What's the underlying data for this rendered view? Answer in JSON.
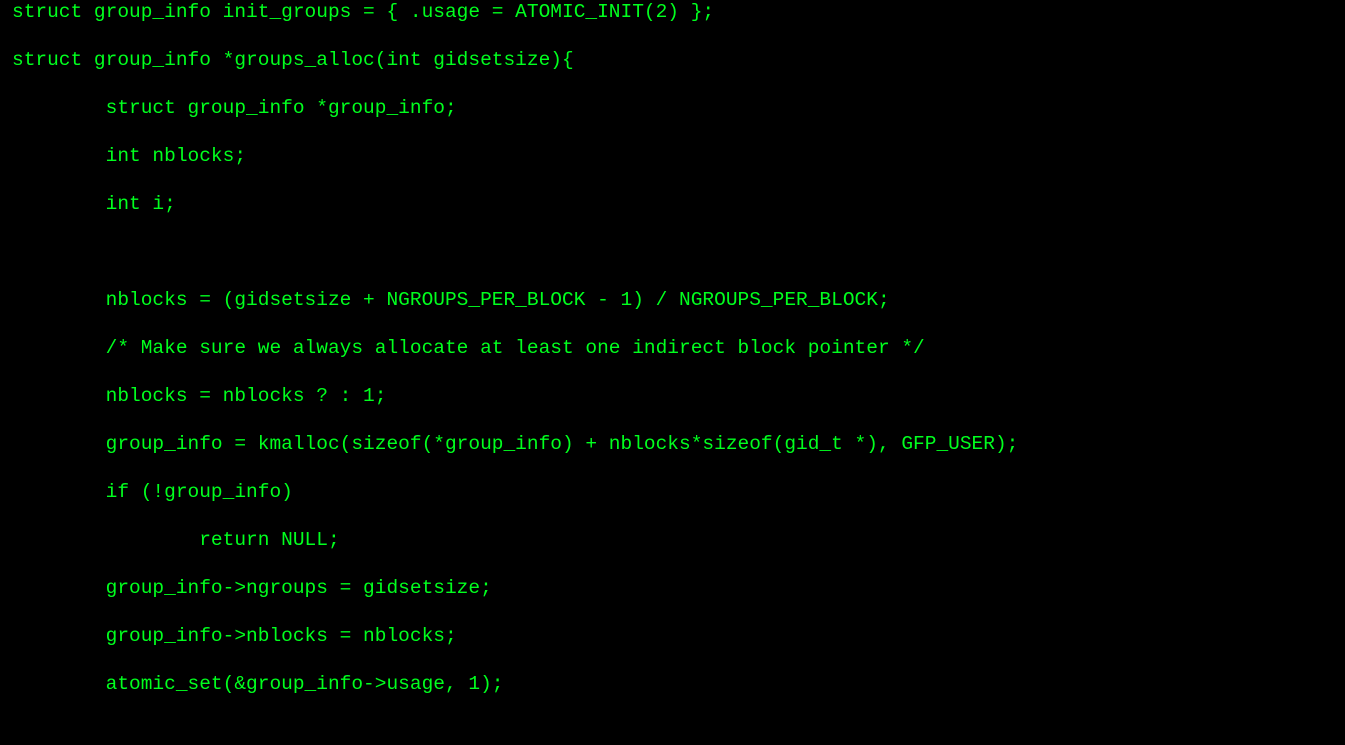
{
  "terminal": {
    "text_color": "#00ff1e",
    "background_color": "#000000",
    "lines": [
      "struct group_info init_groups = { .usage = ATOMIC_INIT(2) };",
      "",
      "struct group_info *groups_alloc(int gidsetsize){",
      "",
      "        struct group_info *group_info;",
      "",
      "        int nblocks;",
      "",
      "        int i;",
      "",
      "",
      "",
      "        nblocks = (gidsetsize + NGROUPS_PER_BLOCK - 1) / NGROUPS_PER_BLOCK;",
      "",
      "        /* Make sure we always allocate at least one indirect block pointer */",
      "",
      "        nblocks = nblocks ? : 1;",
      "",
      "        group_info = kmalloc(sizeof(*group_info) + nblocks*sizeof(gid_t *), GFP_USER);",
      "",
      "        if (!group_info)",
      "",
      "                return NULL;",
      "",
      "        group_info->ngroups = gidsetsize;",
      "",
      "        group_info->nblocks = nblocks;",
      "",
      "        atomic_set(&group_info->usage, 1);"
    ]
  }
}
